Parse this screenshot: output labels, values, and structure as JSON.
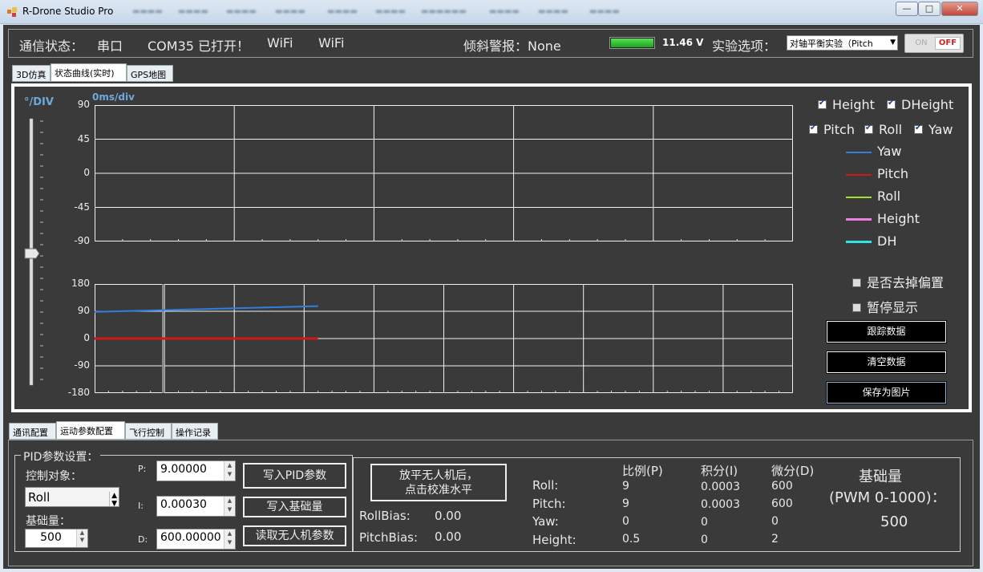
{
  "window": {
    "title": "R-Drone Studio  Pro",
    "minimize_label": "—",
    "maximize_label": "□",
    "close_label": "✕"
  },
  "status": {
    "comm_label": "通信状态：",
    "port_type": "串口",
    "port_status": "COM35 已打开！",
    "wifi_1": "WiFi",
    "wifi_2": "WiFi",
    "tilt_alarm": "倾斜警报：None",
    "battery_fraction": 1.0,
    "voltage": "11.46 V",
    "experiment_label": "实验选项：",
    "experiment_value": "对轴平衡实验（Pitch",
    "toggle_on": "ON",
    "toggle_off": "OFF"
  },
  "top_tabs": [
    "3D仿真",
    "状态曲线(实时)",
    "GPS地图"
  ],
  "chart_labels": {
    "deg_per_div": "°/DIV",
    "ms_per_div": "0ms/div"
  },
  "chart_data": [
    {
      "type": "line",
      "ylim": [
        -90,
        90
      ],
      "yticks": [
        "90",
        "45",
        "0",
        "-45",
        "-90"
      ],
      "series": []
    },
    {
      "type": "line",
      "ylim": [
        -180,
        180
      ],
      "yticks": [
        "180",
        "90",
        "0",
        "-90",
        "-180"
      ],
      "x": [
        0,
        0.32
      ],
      "series": [
        {
          "name": "Yaw",
          "color": "#2f7ee0",
          "values": [
            88,
            107
          ]
        },
        {
          "name": "Pitch",
          "color": "#d01818",
          "values": [
            0,
            0
          ]
        },
        {
          "name": "Roll",
          "color": "#a4e030",
          "values": [
            0,
            0
          ]
        },
        {
          "name": "Height",
          "color": "#ee7de0",
          "values": [
            0,
            0
          ]
        },
        {
          "name": "DH",
          "color": "#2fe3e8",
          "values": [
            0,
            0
          ]
        }
      ]
    }
  ],
  "checkboxes": {
    "height": "Height",
    "dheight": "DHeight",
    "pitch": "Pitch",
    "roll": "Roll",
    "yaw": "Yaw"
  },
  "legend": [
    {
      "name": "Yaw",
      "color": "#2f7ee0"
    },
    {
      "name": "Pitch",
      "color": "#d01818"
    },
    {
      "name": "Roll",
      "color": "#a4e030"
    },
    {
      "name": "Height",
      "color": "#ee7de0"
    },
    {
      "name": "DH",
      "color": "#2fe3e8"
    }
  ],
  "options": {
    "remove_bias": "是否去掉偏置",
    "pause_display": "暂停显示"
  },
  "buttons": {
    "track_data": "跟踪数据",
    "clear_data": "清空数据",
    "save_image": "保存为图片"
  },
  "bottom_tabs": [
    "通讯配置",
    "运动参数配置",
    "飞行控制",
    "操作记录"
  ],
  "pid": {
    "group_title": "PID参数设置：",
    "control_target_label": "控制对象：",
    "control_target_value": "Roll",
    "base_label": "基础量：",
    "base_value": "500",
    "p_label": "P:",
    "p_value": "9.00000",
    "i_label": "I:",
    "i_value": "0.00030",
    "d_label": "D:",
    "d_value": "600.00000",
    "write_pid": "写入PID参数",
    "write_base": "写入基础量",
    "read_params": "读取无人机参数"
  },
  "calibrate": {
    "button_line1": "放平无人机后，",
    "button_line2": "点击校准水平",
    "roll_bias_label": "RollBias:",
    "roll_bias_value": "0.00",
    "pitch_bias_label": "PitchBias:",
    "pitch_bias_value": "0.00"
  },
  "param_table": {
    "headers": [
      "比例(P)",
      "积分(I)",
      "微分(D)"
    ],
    "rows": [
      {
        "name": "Roll:",
        "p": "9",
        "i": "0.0003",
        "d": "600"
      },
      {
        "name": "Pitch:",
        "p": "9",
        "i": "0.0003",
        "d": "600"
      },
      {
        "name": "Yaw:",
        "p": "0",
        "i": "0",
        "d": "0"
      },
      {
        "name": "Height:",
        "p": "0.5",
        "i": "0",
        "d": "2"
      }
    ]
  },
  "base_display": {
    "title": "基础量",
    "subtitle": "(PWM 0-1000)：",
    "value": "500"
  }
}
